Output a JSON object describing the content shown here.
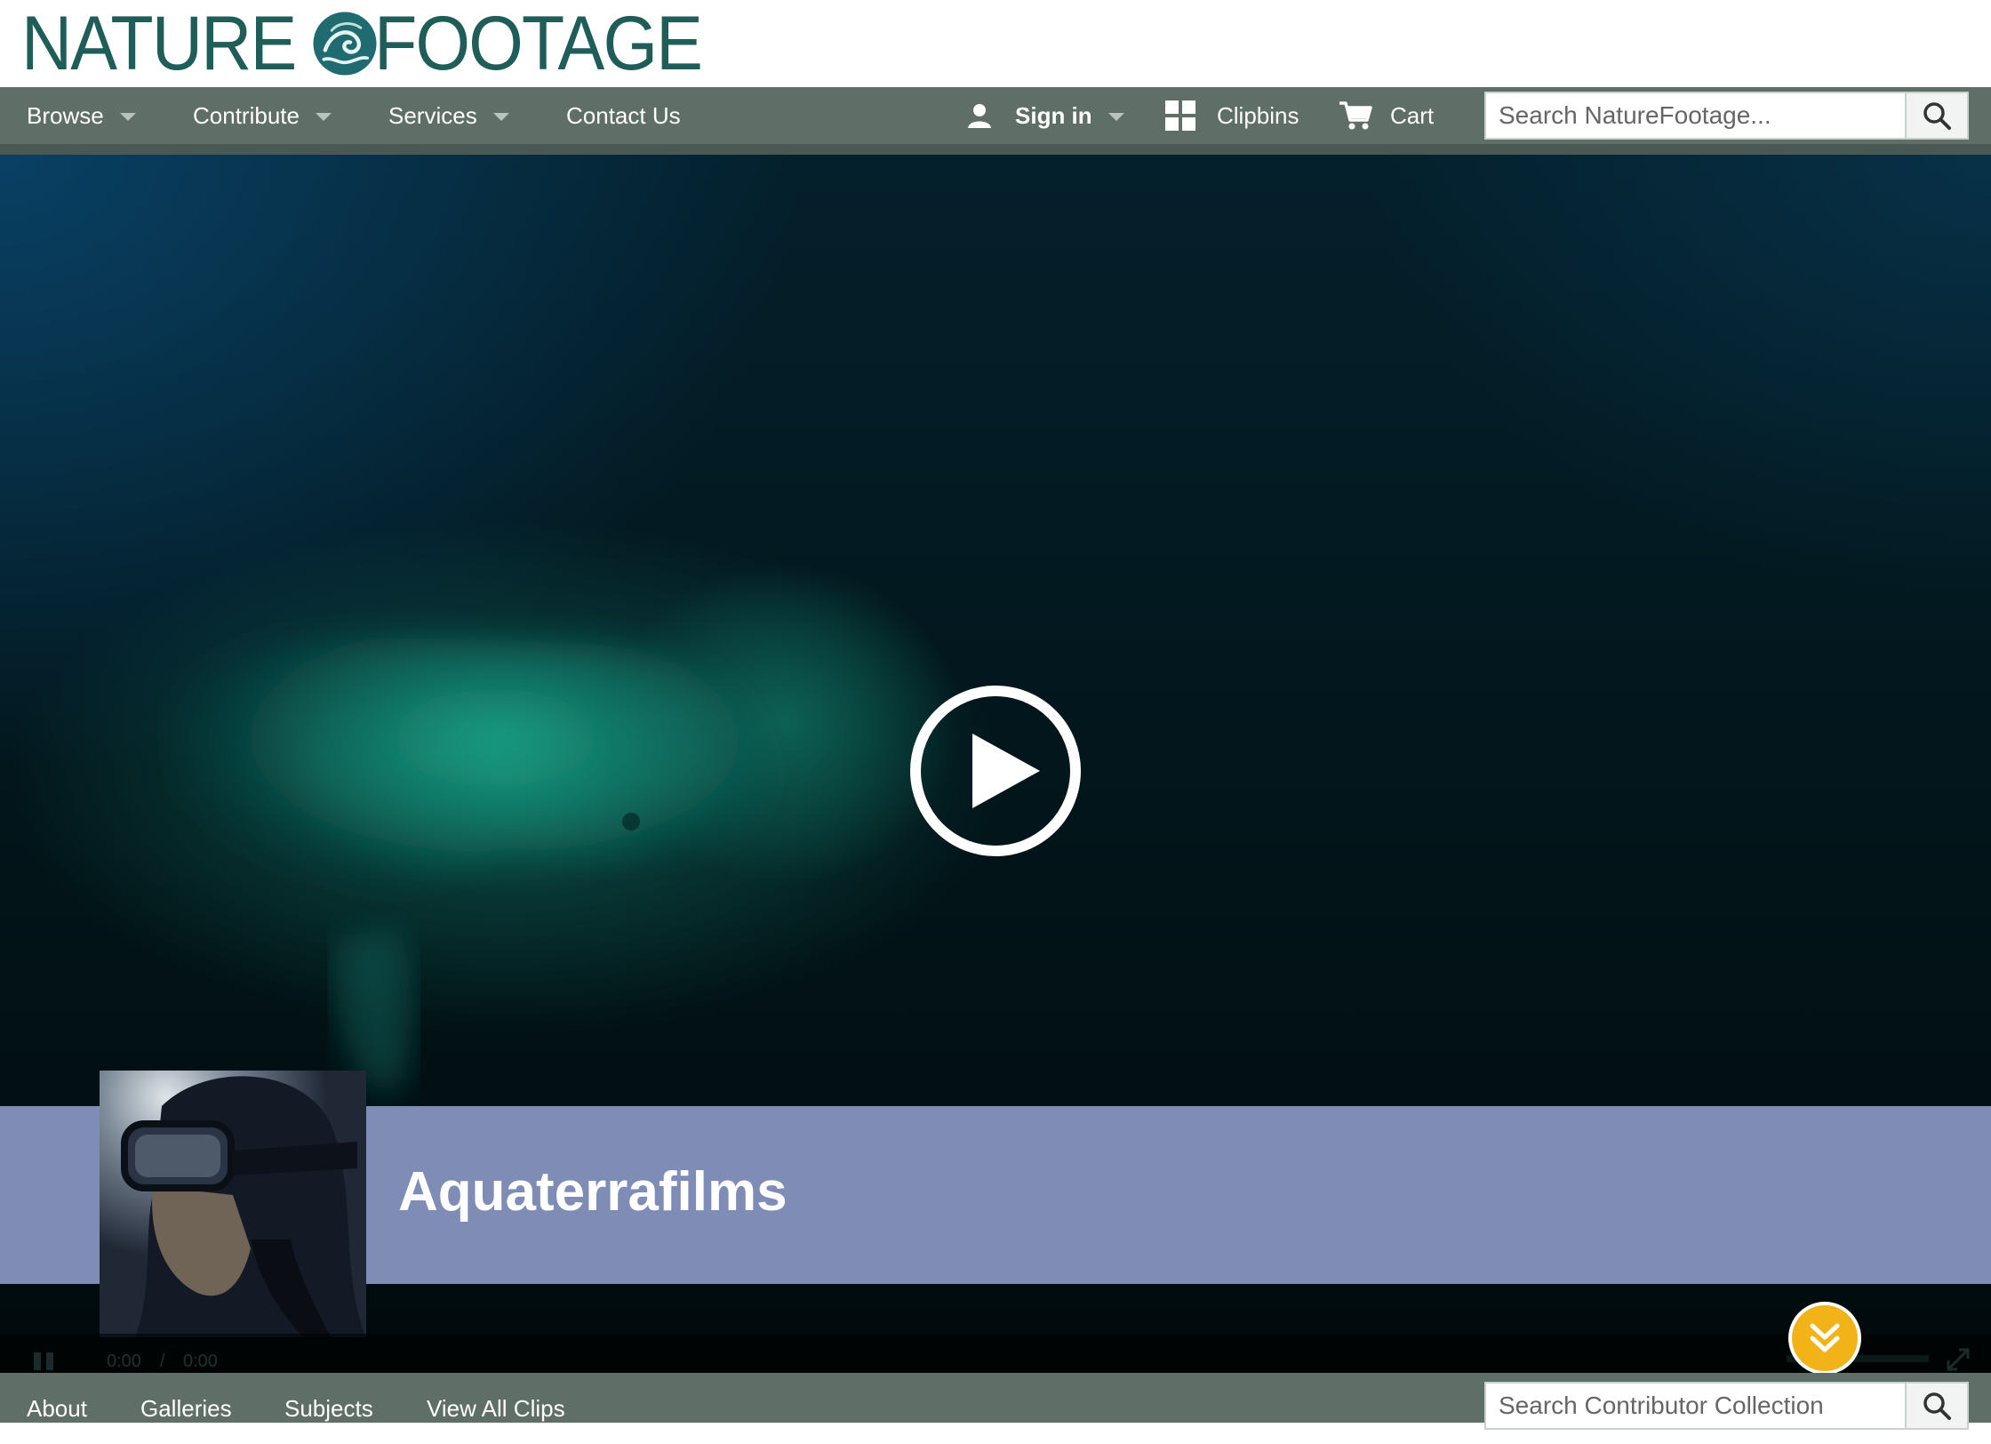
{
  "brand": {
    "name_left": "NATURE",
    "name_right": "FOOTAGE",
    "color": "#1f5d58"
  },
  "main_nav": {
    "browse": "Browse",
    "contribute": "Contribute",
    "services": "Services",
    "contact": "Contact Us",
    "sign_in": "Sign in",
    "clipbins": "Clipbins",
    "cart": "Cart",
    "search_placeholder": "Search NatureFootage...",
    "icons": [
      "user-icon",
      "clipbins-icon",
      "cart-icon",
      "search-icon"
    ]
  },
  "hero": {
    "play_icon": "play-icon"
  },
  "contributor": {
    "name": "Aquaterrafilms",
    "band_color": "#7f8db6"
  },
  "player": {
    "current_time": "0:00",
    "separator": "/",
    "duration": "0:00",
    "scroll_icon": "double-chevron-down-icon",
    "scroll_color": "#f2b318"
  },
  "sub_nav": {
    "about": "About",
    "galleries": "Galleries",
    "subjects": "Subjects",
    "view_all": "View All Clips",
    "search_placeholder": "Search Contributor Collection"
  },
  "colors": {
    "nav_bg": "#5f6e66"
  }
}
